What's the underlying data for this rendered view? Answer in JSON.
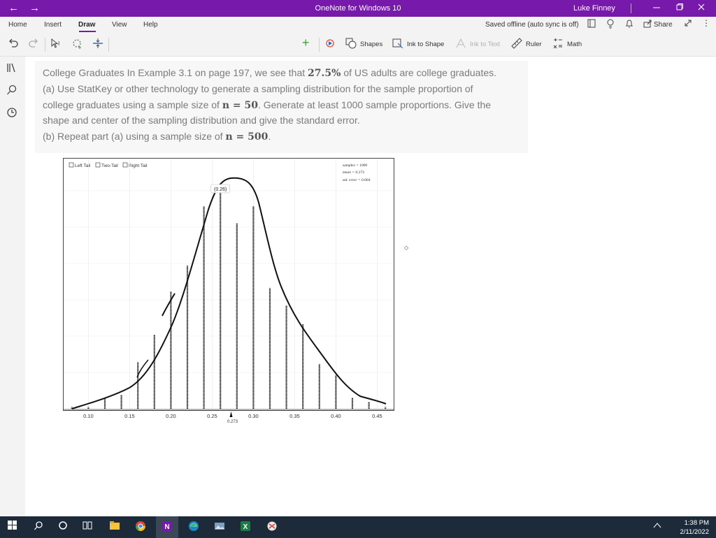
{
  "titlebar": {
    "title": "OneNote for Windows 10",
    "user": "Luke Finney",
    "back_glyph": "←",
    "forward_glyph": "→"
  },
  "menu": {
    "tabs": [
      "Home",
      "Insert",
      "Draw",
      "View",
      "Help"
    ],
    "active_tab": "Draw",
    "status": "Saved offline (auto sync is off)",
    "share": "Share"
  },
  "ribbon": {
    "shapes": "Shapes",
    "ink_to_shape": "Ink to Shape",
    "ink_to_text": "Ink to Text",
    "ruler": "Ruler",
    "math": "Math",
    "pens": [
      {
        "color": "#1a1a1a",
        "tip": "#d946a8"
      },
      {
        "color": "#1a1a1a",
        "tip": "#5fcf3c"
      },
      {
        "color": "#1a1a1a",
        "tip": "#f4f125"
      },
      {
        "color": "#1a1a1a",
        "tip": "#1a1a1a"
      },
      {
        "color": "#1a1a1a",
        "tip": "#4fb3ff"
      },
      {
        "color": "#1a1a1a",
        "tip": "#d0279a"
      },
      {
        "color": "#1a1a1a",
        "tip": "#63d43a"
      },
      {
        "color": "#1a1a1a",
        "tip": "#1d6fd6"
      },
      {
        "color": "#1a1a1a",
        "tip": "#f2a51a"
      }
    ]
  },
  "question": {
    "line1_pre": "College Graduates In Example 3.1 on page 197, we see that ",
    "line1_bold": "27.5%",
    "line1_post": " of US adults are college graduates.",
    "line2": "(a) Use StatKey or other technology to generate a sampling distribution for the sample proportion of",
    "line3_pre": "college graduates using a sample size of ",
    "line3_bold": "n = 50",
    "line3_post": ". Generate at least 1000 sample proportions. Give the",
    "line4": "shape and center of the sampling distribution and give the standard error.",
    "line5_pre": "(b) Repeat part (a) using a sample size of ",
    "line5_bold": "n = 500",
    "line5_post": "."
  },
  "chart_data": {
    "type": "bar",
    "tail_options": [
      "Left Tail",
      "Two-Tail",
      "Right Tail"
    ],
    "stats": [
      "samples = 1000",
      "mean = 0.273",
      "std. error = 0.064"
    ],
    "xlim": [
      0.07,
      0.47
    ],
    "x_ticks": [
      "0.10",
      "0.15",
      "0.20",
      "0.25",
      "0.30",
      "0.35",
      "0.40",
      "0.45"
    ],
    "x_tick_values": [
      0.1,
      0.15,
      0.2,
      0.25,
      0.3,
      0.35,
      0.4,
      0.45
    ],
    "mean_marker_label": "0.273",
    "mean_value": 0.273,
    "selected_bar_label": "(0.26)",
    "selected_bar_x": 0.26,
    "x": [
      0.08,
      0.1,
      0.12,
      0.14,
      0.16,
      0.18,
      0.2,
      0.22,
      0.24,
      0.26,
      0.28,
      0.3,
      0.32,
      0.34,
      0.36,
      0.38,
      0.4,
      0.42,
      0.44,
      0.46
    ],
    "values": [
      2,
      2,
      12,
      16,
      54,
      86,
      136,
      166,
      235,
      260,
      215,
      235,
      140,
      120,
      98,
      52,
      39,
      13,
      8,
      2
    ],
    "ylim": [
      0,
      270
    ]
  },
  "taskbar": {
    "time": "1:38 PM",
    "date": "2/11/2022"
  }
}
